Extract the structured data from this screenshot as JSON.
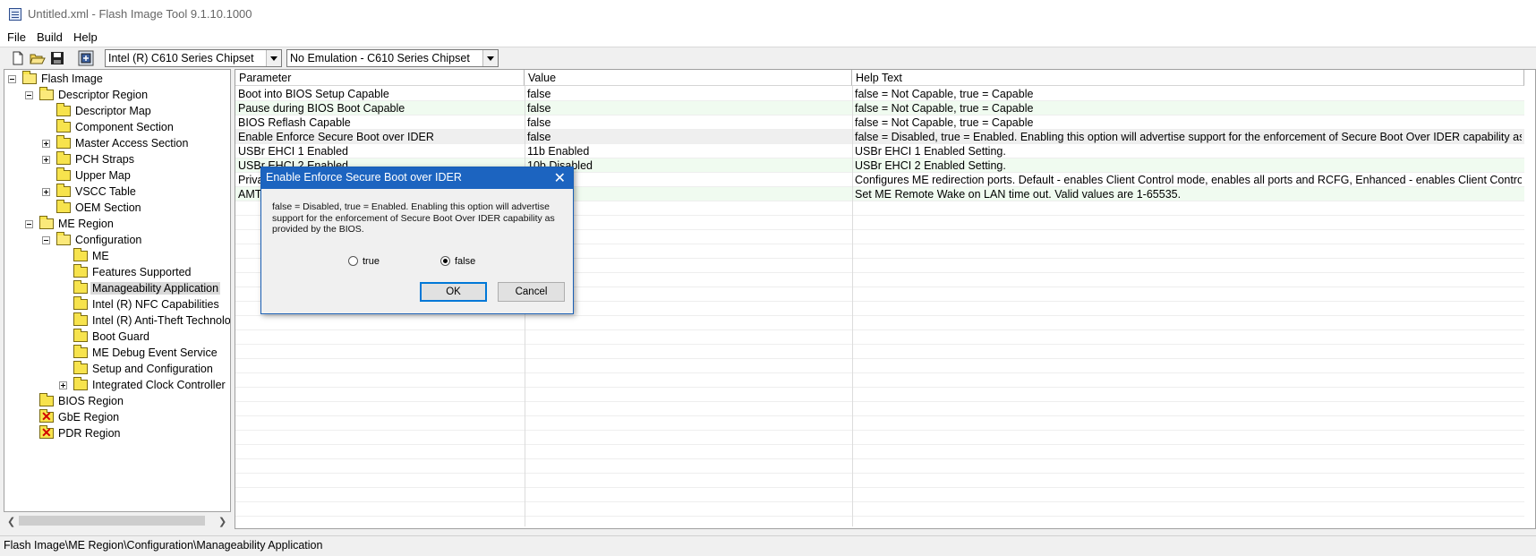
{
  "window": {
    "title": "Untitled.xml - Flash Image Tool 9.1.10.1000"
  },
  "menu": [
    "File",
    "Build",
    "Help"
  ],
  "toolbar": {
    "icons": [
      "new-file-icon",
      "open-folder-icon",
      "save-icon",
      "build-image-icon"
    ],
    "chipset_value": "Intel (R) C610 Series Chipset",
    "emulation_value": "No Emulation - C610 Series Chipset"
  },
  "tree": [
    {
      "label": "Flash Image",
      "expander": "minus",
      "icon": "folder-open-icon"
    },
    {
      "label": "Descriptor Region",
      "expander": "minus",
      "icon": "folder-open-icon"
    },
    {
      "label": "Descriptor Map",
      "expander": "",
      "icon": "folder-icon"
    },
    {
      "label": "Component Section",
      "expander": "",
      "icon": "folder-icon"
    },
    {
      "label": "Master Access Section",
      "expander": "plus",
      "icon": "folder-icon"
    },
    {
      "label": "PCH Straps",
      "expander": "plus",
      "icon": "folder-icon"
    },
    {
      "label": "Upper Map",
      "expander": "",
      "icon": "folder-icon"
    },
    {
      "label": "VSCC Table",
      "expander": "plus",
      "icon": "folder-icon"
    },
    {
      "label": "OEM Section",
      "expander": "",
      "icon": "folder-icon"
    },
    {
      "label": "ME Region",
      "expander": "minus",
      "icon": "folder-open-icon"
    },
    {
      "label": "Configuration",
      "expander": "minus",
      "icon": "folder-open-icon"
    },
    {
      "label": "ME",
      "expander": "",
      "icon": "folder-icon"
    },
    {
      "label": "Features Supported",
      "expander": "",
      "icon": "folder-icon"
    },
    {
      "label": "Manageability Application",
      "expander": "",
      "icon": "folder-icon",
      "selected": true
    },
    {
      "label": "Intel (R) NFC Capabilities",
      "expander": "",
      "icon": "folder-icon"
    },
    {
      "label": "Intel (R) Anti-Theft Technolog",
      "expander": "",
      "icon": "folder-icon"
    },
    {
      "label": "Boot Guard",
      "expander": "",
      "icon": "folder-icon"
    },
    {
      "label": "ME Debug Event Service",
      "expander": "",
      "icon": "folder-icon"
    },
    {
      "label": "Setup and Configuration",
      "expander": "",
      "icon": "folder-icon"
    },
    {
      "label": "Integrated Clock Controller",
      "expander": "plus",
      "icon": "folder-icon"
    },
    {
      "label": "BIOS Region",
      "expander": "",
      "icon": "folder-icon"
    },
    {
      "label": "GbE Region",
      "expander": "",
      "icon": "folder-disabled-icon"
    },
    {
      "label": "PDR Region",
      "expander": "",
      "icon": "folder-disabled-icon"
    }
  ],
  "grid": {
    "columns": [
      "Parameter",
      "Value",
      "Help Text"
    ],
    "rows": [
      [
        "Boot into BIOS Setup Capable",
        "false",
        "false = Not Capable, true = Capable"
      ],
      [
        "Pause during BIOS Boot Capable",
        "false",
        "false = Not Capable, true = Capable"
      ],
      [
        "BIOS Reflash Capable",
        "false",
        "false = Not Capable, true = Capable"
      ],
      [
        "Enable Enforce Secure Boot over IDER",
        "false",
        "false = Disabled, true = Enabled. Enabling this option will advertise support for the enforcement of Secure Boot Over IDER capability as pro..."
      ],
      [
        "USBr EHCI 1 Enabled",
        "11b Enabled",
        "USBr EHCI 1 Enabled Setting."
      ],
      [
        "USBr EHCI 2 Enabled",
        "10b Disabled",
        "USBr EHCI 2 Enabled Setting."
      ],
      [
        "Priva",
        "",
        "Configures ME redirection ports. Default - enables Client Control mode, enables all ports and RCFG, Enhanced - enables Client Control mo..."
      ],
      [
        "AMT",
        "",
        "Set ME Remote Wake on LAN time out. Valid values are 1-65535."
      ]
    ]
  },
  "dialog": {
    "title": "Enable Enforce Secure Boot over IDER",
    "message": "false = Disabled, true = Enabled. Enabling this option will advertise support for the enforcement of Secure Boot Over IDER capability as provided by the BIOS.",
    "options": [
      "true",
      "false"
    ],
    "selected": "false",
    "ok_label": "OK",
    "cancel_label": "Cancel"
  },
  "status": {
    "path": "Flash Image\\ME Region\\Configuration\\Manageability Application"
  }
}
